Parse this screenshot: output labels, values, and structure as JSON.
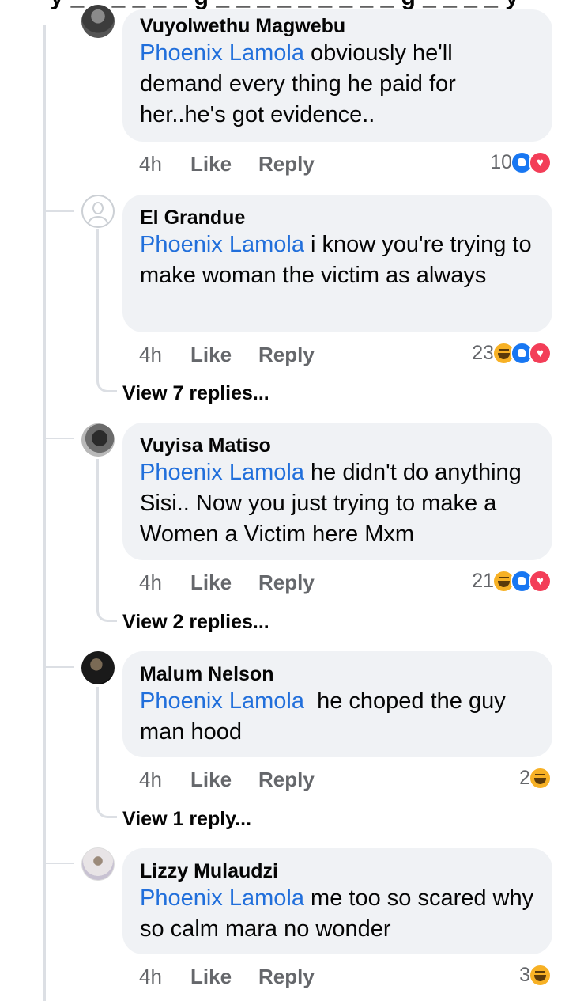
{
  "top_partial_text": "y _ _ _ _ _ _ g _ _ _ _ _ _ _ _ _ g _ _ _ _ y",
  "comments": [
    {
      "name": "Vuyolwethu Magwebu",
      "tag": "Phoenix Lamola",
      "text": " obviously he'll demand every thing he paid for her..he's got evidence..",
      "time": "4h",
      "like": "Like",
      "reply": "Reply",
      "reaction_count": "10",
      "reactions": [
        "like",
        "love"
      ]
    },
    {
      "name": "El Grandue",
      "tag": "Phoenix Lamola",
      "text": " i know you're trying to make woman the victim as always",
      "time": "4h",
      "like": "Like",
      "reply": "Reply",
      "reaction_count": "23",
      "reactions": [
        "haha",
        "like",
        "love"
      ],
      "view_replies": "View 7 replies..."
    },
    {
      "name": "Vuyisa Matiso",
      "tag": "Phoenix Lamola",
      "text": " he didn't do anything Sisi.. Now you just trying to make a Women a Victim here Mxm",
      "time": "4h",
      "like": "Like",
      "reply": "Reply",
      "reaction_count": "21",
      "reactions": [
        "haha",
        "like",
        "love"
      ],
      "view_replies": "View 2 replies..."
    },
    {
      "name": "Malum Nelson",
      "tag": "Phoenix Lamola",
      "text": "  he choped the guy man hood",
      "time": "4h",
      "like": "Like",
      "reply": "Reply",
      "reaction_count": "2",
      "reactions": [
        "haha"
      ],
      "view_replies": "View 1 reply..."
    },
    {
      "name": "Lizzy Mulaudzi",
      "tag": "Phoenix Lamola",
      "text": " me too so scared why so calm mara no wonder",
      "time": "4h",
      "like": "Like",
      "reply": "Reply",
      "reaction_count": "3",
      "reactions": [
        "haha"
      ]
    }
  ],
  "colors": {
    "tag": "#216fdb",
    "bubble": "#f0f2f5",
    "meta": "#65676b",
    "like_reaction": "#1877f2",
    "love_reaction": "#f33e58",
    "haha_reaction": "#f7b125"
  }
}
